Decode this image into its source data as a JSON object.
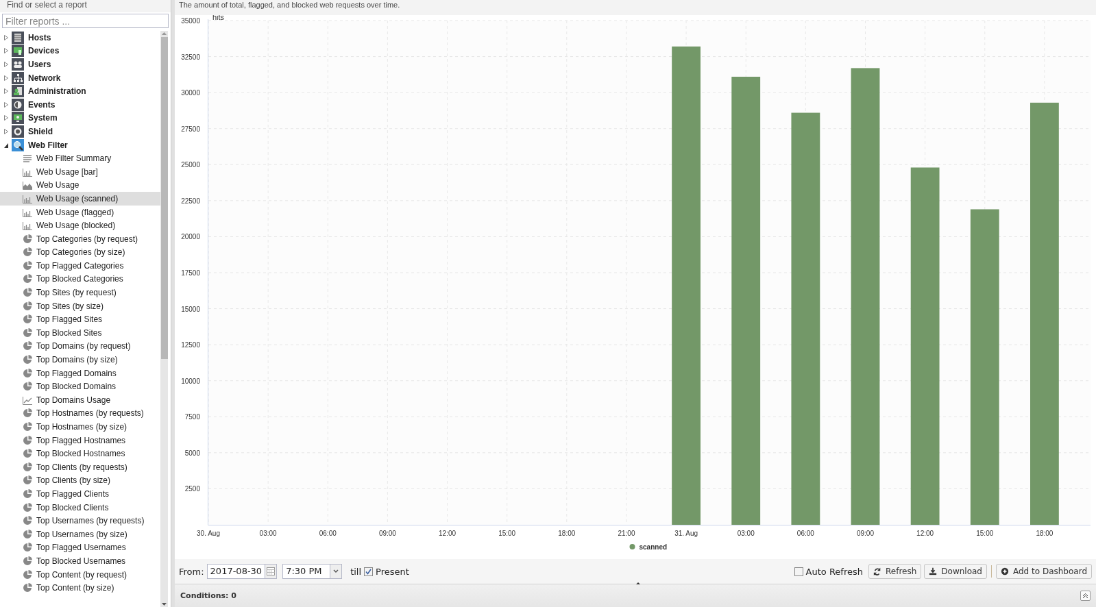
{
  "sidebar": {
    "title": "Find or select a report",
    "filter": {
      "placeholder": "Filter reports ..."
    },
    "categories": [
      {
        "label": "Hosts",
        "expanded": false
      },
      {
        "label": "Devices",
        "expanded": false
      },
      {
        "label": "Users",
        "expanded": false
      },
      {
        "label": "Network",
        "expanded": false
      },
      {
        "label": "Administration",
        "expanded": false
      },
      {
        "label": "Events",
        "expanded": false
      },
      {
        "label": "System",
        "expanded": false
      },
      {
        "label": "Shield",
        "expanded": false
      },
      {
        "label": "Web Filter",
        "expanded": true,
        "children": [
          {
            "label": "Web Filter Summary",
            "kind": "text",
            "selected": false
          },
          {
            "label": "Web Usage [bar]",
            "kind": "bar",
            "selected": false
          },
          {
            "label": "Web Usage",
            "kind": "area",
            "selected": false
          },
          {
            "label": "Web Usage (scanned)",
            "kind": "bar",
            "selected": true
          },
          {
            "label": "Web Usage (flagged)",
            "kind": "bar",
            "selected": false
          },
          {
            "label": "Web Usage (blocked)",
            "kind": "bar",
            "selected": false
          },
          {
            "label": "Top Categories (by request)",
            "kind": "pie",
            "selected": false
          },
          {
            "label": "Top Categories (by size)",
            "kind": "pie",
            "selected": false
          },
          {
            "label": "Top Flagged Categories",
            "kind": "pie",
            "selected": false
          },
          {
            "label": "Top Blocked Categories",
            "kind": "pie",
            "selected": false
          },
          {
            "label": "Top Sites (by request)",
            "kind": "pie",
            "selected": false
          },
          {
            "label": "Top Sites (by size)",
            "kind": "pie",
            "selected": false
          },
          {
            "label": "Top Flagged Sites",
            "kind": "pie",
            "selected": false
          },
          {
            "label": "Top Blocked Sites",
            "kind": "pie",
            "selected": false
          },
          {
            "label": "Top Domains (by request)",
            "kind": "pie",
            "selected": false
          },
          {
            "label": "Top Domains (by size)",
            "kind": "pie",
            "selected": false
          },
          {
            "label": "Top Flagged Domains",
            "kind": "pie",
            "selected": false
          },
          {
            "label": "Top Blocked Domains",
            "kind": "pie",
            "selected": false
          },
          {
            "label": "Top Domains Usage",
            "kind": "line",
            "selected": false
          },
          {
            "label": "Top Hostnames (by requests)",
            "kind": "pie",
            "selected": false
          },
          {
            "label": "Top Hostnames (by size)",
            "kind": "pie",
            "selected": false
          },
          {
            "label": "Top Flagged Hostnames",
            "kind": "pie",
            "selected": false
          },
          {
            "label": "Top Blocked Hostnames",
            "kind": "pie",
            "selected": false
          },
          {
            "label": "Top Clients (by requests)",
            "kind": "pie",
            "selected": false
          },
          {
            "label": "Top Clients (by size)",
            "kind": "pie",
            "selected": false
          },
          {
            "label": "Top Flagged Clients",
            "kind": "pie",
            "selected": false
          },
          {
            "label": "Top Blocked Clients",
            "kind": "pie",
            "selected": false
          },
          {
            "label": "Top Usernames (by requests)",
            "kind": "pie",
            "selected": false
          },
          {
            "label": "Top Usernames (by size)",
            "kind": "pie",
            "selected": false
          },
          {
            "label": "Top Flagged Usernames",
            "kind": "pie",
            "selected": false
          },
          {
            "label": "Top Blocked Usernames",
            "kind": "pie",
            "selected": false
          },
          {
            "label": "Top Content (by request)",
            "kind": "pie",
            "selected": false
          },
          {
            "label": "Top Content (by size)",
            "kind": "pie",
            "selected": false
          }
        ]
      }
    ]
  },
  "report": {
    "description": "The amount of total, flagged, and blocked web requests over time.",
    "chart_data": {
      "type": "bar",
      "ylabel": "hits",
      "categories": [
        "30. Aug",
        "03:00",
        "06:00",
        "09:00",
        "12:00",
        "15:00",
        "18:00",
        "21:00",
        "31. Aug",
        "03:00",
        "06:00",
        "09:00",
        "12:00",
        "15:00",
        "18:00"
      ],
      "series": [
        {
          "name": "scanned",
          "color": "#739868",
          "values": [
            null,
            null,
            null,
            null,
            null,
            null,
            null,
            null,
            33200,
            31100,
            28600,
            31700,
            24800,
            21900,
            29300
          ]
        }
      ],
      "ylim": [
        0,
        35000
      ],
      "grid": true,
      "yticks": [
        2500,
        5000,
        7500,
        10000,
        12500,
        15000,
        17500,
        20000,
        22500,
        25000,
        27500,
        30000,
        32500,
        35000
      ]
    }
  },
  "toolbar": {
    "from_label": "From:",
    "date": "2017-08-30",
    "time": "7:30 PM",
    "till_label": "till",
    "present": {
      "label": "Present",
      "checked": true
    },
    "auto_refresh": {
      "label": "Auto Refresh",
      "checked": false
    },
    "buttons": [
      {
        "label": "Refresh"
      },
      {
        "label": "Download"
      },
      {
        "label": "Add to Dashboard"
      }
    ]
  },
  "conditions": {
    "label": "Conditions: 0"
  }
}
